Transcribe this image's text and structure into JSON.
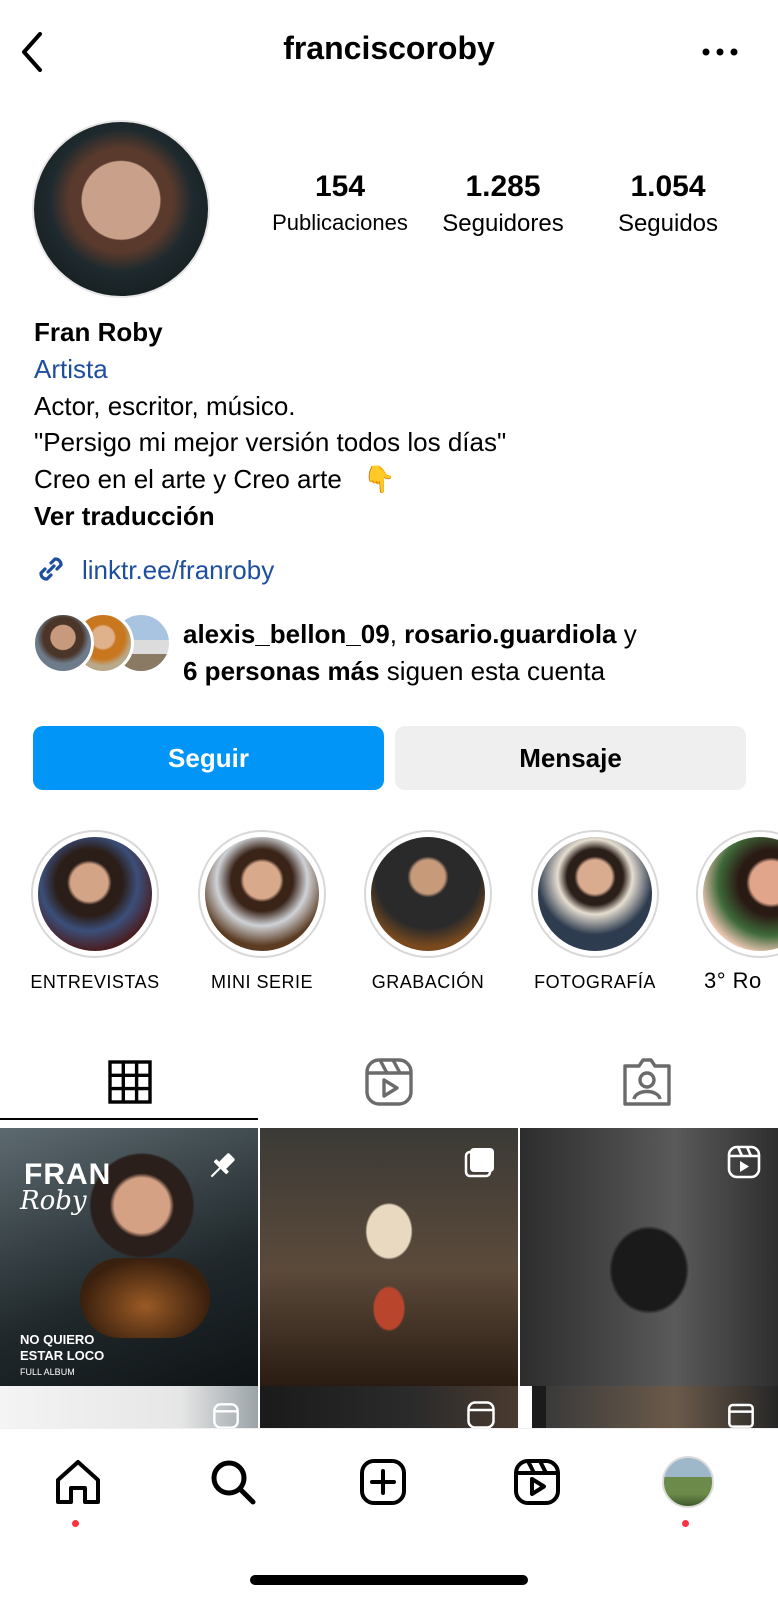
{
  "header": {
    "username": "franciscoroby",
    "back_icon": "chevron-left-icon",
    "more_icon": "more-horizontal-icon"
  },
  "stats": [
    {
      "value": "154",
      "label": "Publicaciones"
    },
    {
      "value": "1.285",
      "label": "Seguidores"
    },
    {
      "value": "1.054",
      "label": "Seguidos"
    }
  ],
  "bio": {
    "name": "Fran Roby",
    "category": "Artista",
    "line1": "Actor, escritor, músico.",
    "line2": "\"Persigo mi mejor versión todos los días\"",
    "line3": "Creo en el arte y Creo arte",
    "line3_emoji": "👇",
    "translate": "Ver traducción",
    "link": "linktr.ee/franroby"
  },
  "followed_by": {
    "user1": "alexis_bellon_09",
    "sep": ", ",
    "user2": "rosario.guardiola",
    "and": " y",
    "others": "6 personas más",
    "rest": " siguen esta cuenta"
  },
  "buttons": {
    "follow": "Seguir",
    "message": "Mensaje"
  },
  "highlights": [
    {
      "label": "ENTREVISTAS"
    },
    {
      "label": "MINI SERIE"
    },
    {
      "label": "GRABACIÓN"
    },
    {
      "label": "FOTOGRAFÍA"
    },
    {
      "label": "3° Ro"
    }
  ],
  "tabs": [
    "grid-icon",
    "reels-icon",
    "tagged-icon"
  ],
  "posts": {
    "post1": {
      "title1": "FRAN",
      "title2": "Roby",
      "caption1": "NO QUIERO",
      "caption2": "ESTAR LOCO",
      "caption3": "FULL ALBUM"
    }
  },
  "nav": [
    "home-icon",
    "search-icon",
    "create-icon",
    "reels-icon",
    "profile-avatar"
  ],
  "colors": {
    "accent": "#0095f6",
    "link": "#1d4ea0",
    "notification": "#ff3040"
  }
}
